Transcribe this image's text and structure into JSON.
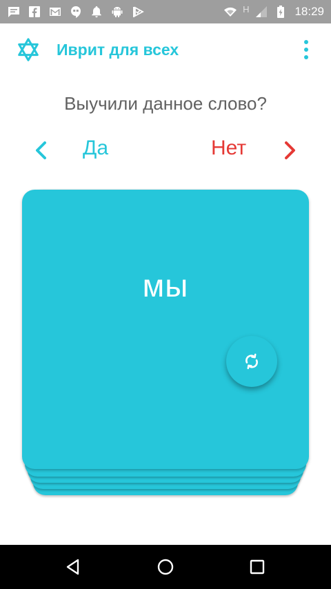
{
  "status_bar": {
    "time": "18:29",
    "network_label": "H",
    "left_icons": [
      "message-icon",
      "facebook-icon",
      "gmail-icon",
      "hangouts-icon",
      "bell-icon",
      "android-icon",
      "check-flag-icon"
    ],
    "right_icons": [
      "wifi-icon",
      "signal-icon",
      "battery-icon"
    ]
  },
  "app_bar": {
    "title": "Иврит для всех",
    "logo_icon": "star-of-david-icon",
    "menu_icon": "more-vert-icon"
  },
  "question": "Выучили данное слово?",
  "answers": {
    "yes_label": "Да",
    "no_label": "Нет"
  },
  "card": {
    "word": "мы",
    "flip_icon": "refresh-icon"
  },
  "colors": {
    "accent": "#26c6da",
    "no": "#e53935",
    "question_text": "#616161",
    "status_bar": "#9e9e9e",
    "nav_bar": "#000000"
  },
  "nav_bar": {
    "buttons": [
      "back-icon",
      "home-icon",
      "recents-icon"
    ]
  }
}
